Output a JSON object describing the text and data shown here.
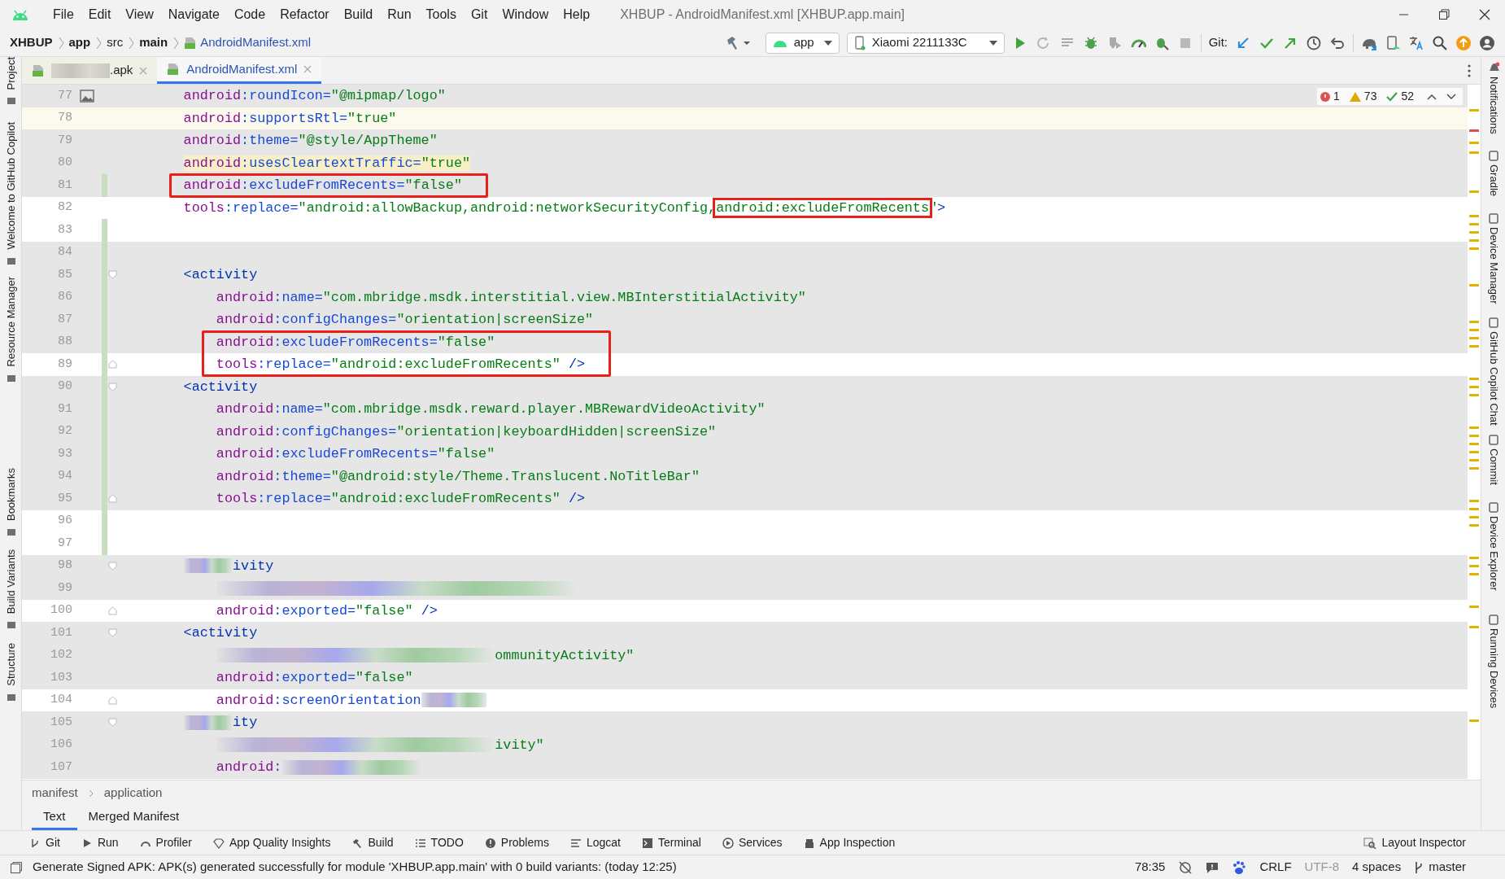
{
  "window": {
    "title": "XHBUP - AndroidManifest.xml [XHBUP.app.main]"
  },
  "menu": [
    "File",
    "Edit",
    "View",
    "Navigate",
    "Code",
    "Refactor",
    "Build",
    "Run",
    "Tools",
    "Git",
    "Window",
    "Help"
  ],
  "breadcrumbs": [
    {
      "label": "XHBUP",
      "bold": true,
      "kind": "folder"
    },
    {
      "label": "app",
      "bold": true,
      "kind": "folder"
    },
    {
      "label": "src",
      "bold": false,
      "kind": "folder"
    },
    {
      "label": "main",
      "bold": true,
      "kind": "folder"
    },
    {
      "label": "AndroidManifest.xml",
      "bold": false,
      "kind": "file"
    }
  ],
  "run_config": "app",
  "device": "Xiaomi 2211133C",
  "git_label": "Git:",
  "editor_tabs": [
    {
      "label": ".apk",
      "selected": false,
      "blurred": true
    },
    {
      "label": "AndroidManifest.xml",
      "selected": true,
      "blurred": false
    }
  ],
  "inspections": {
    "errors": "1",
    "warnings": "73",
    "ok": "52"
  },
  "lines": [
    {
      "number": "77",
      "kind": "application-attribute",
      "shaded": true,
      "current": false,
      "changed": false,
      "boxed": false,
      "image_marker": true,
      "fold_marker": false,
      "tokens": [
        {
          "text": "android",
          "kind": "ns"
        },
        {
          "text": ":roundIcon=",
          "kind": "attr"
        },
        {
          "text": "\"@mipmap/logo\"",
          "kind": "val"
        }
      ]
    },
    {
      "number": "78",
      "kind": "application-attribute",
      "shaded": false,
      "current": true,
      "changed": false,
      "boxed": false,
      "image_marker": false,
      "fold_marker": false,
      "tokens": [
        {
          "text": "android",
          "kind": "ns"
        },
        {
          "text": ":supportsRtl=",
          "kind": "attr"
        },
        {
          "text": "\"true\"",
          "kind": "val"
        }
      ]
    },
    {
      "number": "79",
      "kind": "application-attribute",
      "shaded": true,
      "current": false,
      "changed": false,
      "boxed": false,
      "image_marker": false,
      "fold_marker": false,
      "tokens": [
        {
          "text": "android",
          "kind": "ns"
        },
        {
          "text": ":theme=",
          "kind": "attr"
        },
        {
          "text": "\"@style/AppTheme\"",
          "kind": "val"
        }
      ]
    },
    {
      "number": "80",
      "kind": "application-attribute",
      "shaded": true,
      "current": false,
      "changed": false,
      "boxed": false,
      "image_marker": false,
      "fold_marker": false,
      "tokens": [
        {
          "text": "android",
          "kind": "ns",
          "warning": true
        },
        {
          "text": ":usesCleartextTraffic=",
          "kind": "attr",
          "warning": true
        },
        {
          "text": "\"true\"",
          "kind": "val",
          "warning": true
        }
      ]
    },
    {
      "number": "81",
      "kind": "application-attribute",
      "shaded": true,
      "current": false,
      "changed": true,
      "boxed": true,
      "image_marker": false,
      "fold_marker": false,
      "tokens": [
        {
          "text": "android",
          "kind": "ns"
        },
        {
          "text": ":excludeFromRecents=",
          "kind": "attr"
        },
        {
          "text": "\"false\"",
          "kind": "val"
        }
      ]
    },
    {
      "number": "82",
      "kind": "application-attribute",
      "shaded": false,
      "current": false,
      "changed": false,
      "boxed": false,
      "image_marker": false,
      "fold_marker": false,
      "tokens": [
        {
          "text": "tools",
          "kind": "ns"
        },
        {
          "text": ":replace=",
          "kind": "attr"
        },
        {
          "text": "\"android:allowBackup,android:networkSecurityConfig,",
          "kind": "val"
        },
        {
          "text": "android:excludeFromRecents",
          "kind": "val",
          "boxed": true
        },
        {
          "text": "\"",
          "kind": "val"
        },
        {
          "text": ">",
          "kind": "tag"
        }
      ]
    },
    {
      "number": "83",
      "kind": "blank",
      "shaded": false,
      "current": false,
      "changed": true,
      "boxed": false,
      "image_marker": false,
      "fold_marker": false
    },
    {
      "number": "84",
      "kind": "blank",
      "shaded": true,
      "current": false,
      "changed": true,
      "boxed": false,
      "image_marker": false,
      "fold_marker": false
    },
    {
      "number": "85",
      "kind": "activity-start",
      "shaded": true,
      "current": false,
      "changed": true,
      "boxed": false,
      "image_marker": false,
      "fold_marker": true,
      "tokens": [
        {
          "text": "<activity",
          "kind": "tag"
        }
      ]
    },
    {
      "number": "86",
      "kind": "activity-attribute",
      "shaded": true,
      "current": false,
      "changed": true,
      "boxed": false,
      "image_marker": false,
      "fold_marker": false,
      "tokens": [
        {
          "text": "android",
          "kind": "ns"
        },
        {
          "text": ":name=",
          "kind": "attr"
        },
        {
          "text": "\"com.mbridge.msdk.interstitial.view.MBInterstitialActivity\"",
          "kind": "val"
        }
      ]
    },
    {
      "number": "87",
      "kind": "activity-attribute",
      "shaded": true,
      "current": false,
      "changed": true,
      "boxed": false,
      "image_marker": false,
      "fold_marker": false,
      "tokens": [
        {
          "text": "android",
          "kind": "ns"
        },
        {
          "text": ":configChanges=",
          "kind": "attr"
        },
        {
          "text": "\"orientation|screenSize\"",
          "kind": "val"
        }
      ]
    },
    {
      "number": "88",
      "kind": "activity-attribute",
      "shaded": true,
      "current": false,
      "changed": true,
      "boxed": true,
      "image_marker": false,
      "fold_marker": false,
      "tokens": [
        {
          "text": "android",
          "kind": "ns"
        },
        {
          "text": ":excludeFromRecents=",
          "kind": "attr"
        },
        {
          "text": "\"false\"",
          "kind": "val"
        }
      ]
    },
    {
      "number": "89",
      "kind": "activity-attribute",
      "shaded": false,
      "current": false,
      "changed": true,
      "boxed": true,
      "image_marker": false,
      "fold_marker": true,
      "tokens": [
        {
          "text": "tools",
          "kind": "ns"
        },
        {
          "text": ":replace=",
          "kind": "attr"
        },
        {
          "text": "\"android:excludeFromRecents\"",
          "kind": "val"
        },
        {
          "text": " />",
          "kind": "tag"
        }
      ]
    },
    {
      "number": "90",
      "kind": "activity-start",
      "shaded": true,
      "current": false,
      "changed": true,
      "boxed": false,
      "image_marker": false,
      "fold_marker": true,
      "tokens": [
        {
          "text": "<activity",
          "kind": "tag"
        }
      ]
    },
    {
      "number": "91",
      "kind": "activity-attribute",
      "shaded": true,
      "current": false,
      "changed": true,
      "boxed": false,
      "image_marker": false,
      "fold_marker": false,
      "tokens": [
        {
          "text": "android",
          "kind": "ns"
        },
        {
          "text": ":name=",
          "kind": "attr"
        },
        {
          "text": "\"com.mbridge.msdk.reward.player.MBRewardVideoActivity\"",
          "kind": "val"
        }
      ]
    },
    {
      "number": "92",
      "kind": "activity-attribute",
      "shaded": true,
      "current": false,
      "changed": true,
      "boxed": false,
      "image_marker": false,
      "fold_marker": false,
      "tokens": [
        {
          "text": "android",
          "kind": "ns"
        },
        {
          "text": ":configChanges=",
          "kind": "attr"
        },
        {
          "text": "\"orientation|keyboardHidden|screenSize\"",
          "kind": "val"
        }
      ]
    },
    {
      "number": "93",
      "kind": "activity-attribute",
      "shaded": true,
      "current": false,
      "changed": true,
      "boxed": false,
      "image_marker": false,
      "fold_marker": false,
      "tokens": [
        {
          "text": "android",
          "kind": "ns"
        },
        {
          "text": ":excludeFromRecents=",
          "kind": "attr"
        },
        {
          "text": "\"false\"",
          "kind": "val"
        }
      ]
    },
    {
      "number": "94",
      "kind": "activity-attribute",
      "shaded": true,
      "current": false,
      "changed": true,
      "boxed": false,
      "image_marker": false,
      "fold_marker": false,
      "tokens": [
        {
          "text": "android",
          "kind": "ns"
        },
        {
          "text": ":theme=",
          "kind": "attr"
        },
        {
          "text": "\"@android:style/Theme.Translucent.NoTitleBar\"",
          "kind": "val"
        }
      ]
    },
    {
      "number": "95",
      "kind": "activity-attribute",
      "shaded": true,
      "current": false,
      "changed": true,
      "boxed": false,
      "image_marker": false,
      "fold_marker": true,
      "tokens": [
        {
          "text": "tools",
          "kind": "ns"
        },
        {
          "text": ":replace=",
          "kind": "attr"
        },
        {
          "text": "\"android:excludeFromRecents\"",
          "kind": "val"
        },
        {
          "text": " />",
          "kind": "tag"
        }
      ]
    },
    {
      "number": "96",
      "kind": "blank",
      "shaded": false,
      "current": false,
      "changed": true,
      "boxed": false,
      "image_marker": false,
      "fold_marker": false
    },
    {
      "number": "97",
      "kind": "blank",
      "shaded": false,
      "current": false,
      "changed": true,
      "boxed": false,
      "image_marker": false,
      "fold_marker": false
    },
    {
      "number": "98",
      "kind": "activity-start",
      "shaded": true,
      "current": false,
      "changed": false,
      "boxed": false,
      "image_marker": false,
      "fold_marker": true,
      "tokens": [
        {
          "kind": "blur"
        },
        {
          "text": "ivity",
          "kind": "tag"
        }
      ]
    },
    {
      "number": "99",
      "kind": "activity-attribute",
      "shaded": true,
      "current": false,
      "changed": false,
      "boxed": false,
      "image_marker": false,
      "fold_marker": false,
      "tokens": [
        {
          "kind": "blur"
        }
      ]
    },
    {
      "number": "100",
      "kind": "activity-attribute",
      "shaded": false,
      "current": false,
      "changed": false,
      "boxed": false,
      "image_marker": false,
      "fold_marker": true,
      "tokens": [
        {
          "text": "android",
          "kind": "ns"
        },
        {
          "text": ":exported=",
          "kind": "attr"
        },
        {
          "text": "\"false\"",
          "kind": "val"
        },
        {
          "text": " />",
          "kind": "tag"
        }
      ]
    },
    {
      "number": "101",
      "kind": "activity-start",
      "shaded": true,
      "current": false,
      "changed": false,
      "boxed": false,
      "image_marker": false,
      "fold_marker": true,
      "tokens": [
        {
          "text": "<activity",
          "kind": "tag"
        }
      ]
    },
    {
      "number": "102",
      "kind": "activity-attribute",
      "shaded": true,
      "current": false,
      "changed": false,
      "boxed": false,
      "image_marker": false,
      "fold_marker": false,
      "tokens": [
        {
          "kind": "blur"
        },
        {
          "text": "ommunityActivity\"",
          "kind": "val"
        }
      ]
    },
    {
      "number": "103",
      "kind": "activity-attribute",
      "shaded": true,
      "current": false,
      "changed": false,
      "boxed": false,
      "image_marker": false,
      "fold_marker": false,
      "tokens": [
        {
          "text": "android",
          "kind": "ns"
        },
        {
          "text": ":exported=",
          "kind": "attr"
        },
        {
          "text": "\"false\"",
          "kind": "val"
        }
      ]
    },
    {
      "number": "104",
      "kind": "activity-attribute",
      "shaded": false,
      "current": false,
      "changed": false,
      "boxed": false,
      "image_marker": false,
      "fold_marker": true,
      "tokens": [
        {
          "text": "android",
          "kind": "ns"
        },
        {
          "text": ":screenOrientation",
          "kind": "attr"
        },
        {
          "kind": "blur"
        }
      ]
    },
    {
      "number": "105",
      "kind": "activity-start",
      "shaded": true,
      "current": false,
      "changed": false,
      "boxed": false,
      "image_marker": false,
      "fold_marker": true,
      "tokens": [
        {
          "kind": "blur"
        },
        {
          "text": "ity",
          "kind": "tag"
        }
      ]
    },
    {
      "number": "106",
      "kind": "activity-attribute",
      "shaded": true,
      "current": false,
      "changed": false,
      "boxed": false,
      "image_marker": false,
      "fold_marker": false,
      "tokens": [
        {
          "kind": "blur"
        },
        {
          "text": "ivity\"",
          "kind": "val"
        }
      ]
    },
    {
      "number": "107",
      "kind": "activity-attribute",
      "shaded": true,
      "current": false,
      "changed": false,
      "boxed": false,
      "image_marker": false,
      "fold_marker": false,
      "tokens": [
        {
          "text": "android",
          "kind": "ns"
        },
        {
          "text": ":",
          "kind": "attr"
        },
        {
          "kind": "blur"
        }
      ]
    }
  ],
  "left_tools": [
    "Project",
    "Welcome to GitHub Copilot",
    "Resource Manager",
    "Bookmarks",
    "Build Variants",
    "Structure"
  ],
  "right_tools": [
    {
      "label": "Notifications",
      "badge": true
    },
    {
      "label": "Gradle",
      "badge": false
    },
    {
      "label": "Device Manager",
      "badge": false
    },
    {
      "label": "GitHub Copilot Chat",
      "badge": false
    },
    {
      "label": "Commit",
      "badge": false
    },
    {
      "label": "Device Explorer",
      "badge": false
    },
    {
      "label": "Running Devices",
      "badge": false
    }
  ],
  "path": [
    "manifest",
    "application"
  ],
  "view_tabs": [
    {
      "label": "Text",
      "selected": true
    },
    {
      "label": "Merged Manifest",
      "selected": false
    }
  ],
  "tool_windows": [
    "Git",
    "Run",
    "Profiler",
    "App Quality Insights",
    "Build",
    "TODO",
    "Problems",
    "Logcat",
    "Terminal",
    "Services",
    "App Inspection"
  ],
  "layout_inspector": "Layout Inspector",
  "status": {
    "message": "Generate Signed APK: APK(s) generated successfully for module 'XHBUP.app.main' with 0 build variants: (today 12:25)",
    "position": "78:35",
    "line_separator": "CRLF",
    "encoding": "UTF-8",
    "indent": "4 spaces",
    "branch": "master"
  }
}
